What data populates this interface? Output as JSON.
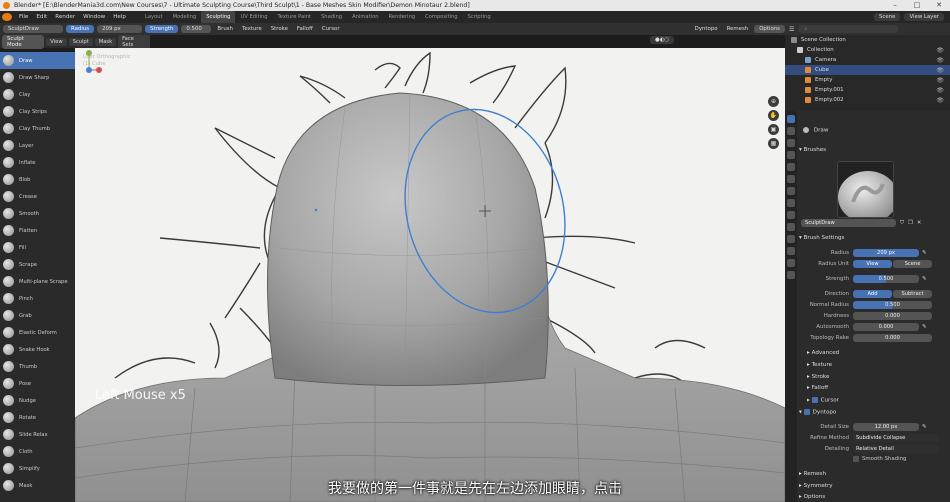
{
  "titlebar": {
    "title": "Blender* [E:\\BlenderMania3d.com\\New Courses\\7 - Ultimate Sculpting Course\\Third Sculpt\\1 - Base Meshes Skin Modifier\\Demon Minotaur 2.blend]"
  },
  "menus": [
    "File",
    "Edit",
    "Render",
    "Window",
    "Help"
  ],
  "workspaces": [
    "Layout",
    "Modeling",
    "Sculpting",
    "UV Editing",
    "Texture Paint",
    "Shading",
    "Animation",
    "Rendering",
    "Compositing",
    "Scripting"
  ],
  "active_workspace": "Sculpting",
  "scene": {
    "label": "Scene",
    "view_layer": "View Layer"
  },
  "tool_header": {
    "brush_name": "SculptDraw",
    "radius_label": "Radius",
    "radius_value": "209 px",
    "strength_label": "Strength",
    "strength_value": "0.500",
    "brush_menu": "Brush",
    "texture_menu": "Texture",
    "stroke_menu": "Stroke",
    "falloff_menu": "Falloff",
    "cursor_menu": "Cursor",
    "dyntopo": "Dyntopo",
    "remesh": "Remesh",
    "options": "Options"
  },
  "view_header": {
    "mode": "Sculpt Mode",
    "view": "View",
    "sculpt": "Sculpt",
    "mask": "Mask",
    "face_sets": "Face Sets"
  },
  "tools": [
    "Draw",
    "Draw Sharp",
    "Clay",
    "Clay Strips",
    "Clay Thumb",
    "Layer",
    "Inflate",
    "Blob",
    "Crease",
    "Smooth",
    "Flatten",
    "Fill",
    "Scrape",
    "Multi-plane Scrape",
    "Pinch",
    "Grab",
    "Elastic Deform",
    "Snake Hook",
    "Thumb",
    "Pose",
    "Nudge",
    "Rotate",
    "Slide Relax",
    "Cloth",
    "Simplify",
    "Mask"
  ],
  "active_tool": "Draw",
  "viewport": {
    "info_line1": "User Orthographic",
    "info_line2": "(1) Cube",
    "operator_msg": "Left Mouse x5"
  },
  "outliner": {
    "search_placeholder": "",
    "items": [
      {
        "name": "Scene Collection",
        "icon_color": "#8a8a8a"
      },
      {
        "name": "Collection",
        "icon_color": "#cccccc"
      },
      {
        "name": "Camera",
        "icon_color": "#7aa0d0"
      },
      {
        "name": "Cube",
        "icon_color": "#e08a3c"
      },
      {
        "name": "Empty",
        "icon_color": "#e08a3c"
      },
      {
        "name": "Empty.001",
        "icon_color": "#e08a3c"
      },
      {
        "name": "Empty.002",
        "icon_color": "#e08a3c"
      }
    ]
  },
  "properties": {
    "tool_name": "Draw",
    "brushes_label": "Brushes",
    "brush_name": "SculptDraw",
    "brush_settings": "Brush Settings",
    "radius_label": "Radius",
    "radius_value": "209 px",
    "radius_unit_label": "Radius Unit",
    "unit_view": "View",
    "unit_scene": "Scene",
    "strength_label": "Strength",
    "strength_value": "0.500",
    "direction_label": "Direction",
    "direction_add": "Add",
    "direction_subtract": "Subtract",
    "normal_radius_label": "Normal Radius",
    "normal_radius_value": "0.500",
    "hardness_label": "Hardness",
    "hardness_value": "0.000",
    "autosmooth_label": "Autosmooth",
    "autosmooth_value": "0.000",
    "topology_rake_label": "Topology Rake",
    "topology_rake_value": "0.000",
    "advanced": "Advanced",
    "texture": "Texture",
    "stroke": "Stroke",
    "falloff": "Falloff",
    "cursor": "Cursor",
    "dyntopo": "Dyntopo",
    "detail_size_label": "Detail Size",
    "detail_size_value": "12.00 px",
    "refine_method_label": "Refine Method",
    "refine_method_value": "Subdivide Collapse",
    "detailing_label": "Detailing",
    "detailing_value": "Relative Detail",
    "smooth_shading": "Smooth Shading",
    "remesh": "Remesh",
    "symmetry": "Symmetry",
    "options": "Options"
  },
  "subtitle": "我要做的第一件事就是先在左边添加眼睛，点击",
  "colors": {
    "accent": "#4772b3",
    "brush_circle": "#3f7fd0",
    "blender_orange": "#e87d0d"
  }
}
